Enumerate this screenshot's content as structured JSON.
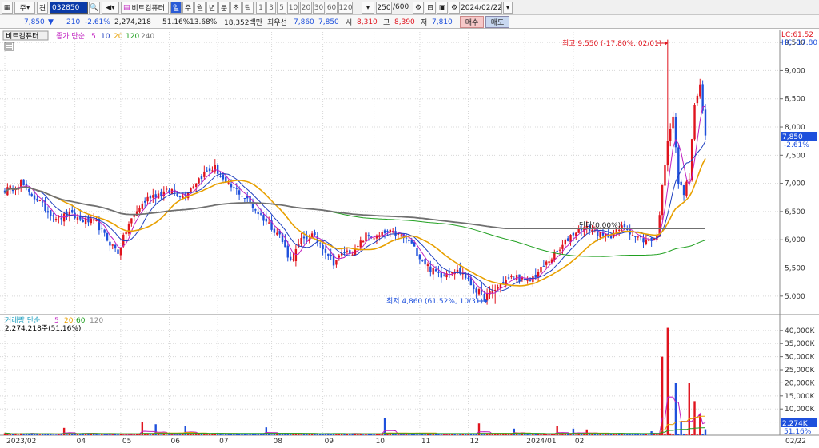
{
  "toolbar": {
    "period_mode": "주",
    "code_prefix": "견",
    "stock_code": "032850",
    "stock_name": "비트컴퓨터",
    "periods": [
      "일",
      "주",
      "월",
      "년",
      "분",
      "초",
      "틱"
    ],
    "minute_options": [
      "1",
      "3",
      "5",
      "10",
      "20",
      "30",
      "60",
      "120"
    ],
    "count": "250",
    "count_total": "/600",
    "date": "2024/02/22"
  },
  "quote": {
    "price": "7,850",
    "direction": "▼",
    "change": "210",
    "change_pct": "-2.61%",
    "volume": "2,274,218",
    "volume_ratio": "51.16%",
    "turnover": "13.68%",
    "amount": "18,352백만",
    "bid_label": "최우선",
    "ask": "7,860",
    "bid": "7,850",
    "open_label": "시",
    "open": "8,310",
    "high_label": "고",
    "high": "8,390",
    "low_label": "저",
    "low": "7,810",
    "buy_label": "매수",
    "sell_label": "매도"
  },
  "legend": {
    "name_tag": "비트컴퓨터",
    "ma_prefix": "종가 단순",
    "ma_periods": [
      "5",
      "10",
      "20",
      "120",
      "240"
    ],
    "vol_prefix": "거래량 단순",
    "vol_periods": [
      "5",
      "20",
      "60",
      "120"
    ],
    "vol_value": "2,274,218주(51.16%)"
  },
  "annotations": {
    "high": "최고 9,550 (-17.80%, 02/01)",
    "low": "최저 4,860 (61.52%, 10/31)",
    "mid": "단타(0.00%)",
    "lc": "LC:61.52",
    "hc": "HC:-17.80",
    "price_tag": "7,850",
    "pct_tag": "-2.61%",
    "vol_tag": "2,274K",
    "vol_pct_tag": "51.16%"
  },
  "colors": {
    "up": "#e0141e",
    "down": "#1e50dc",
    "ma5": "#c020c0",
    "ma10": "#2040c0",
    "ma20": "#e8a000",
    "ma120": "#20a020",
    "ma240": "#707070"
  },
  "chart_data": {
    "type": "candlestick",
    "title": "비트컴퓨터",
    "ylim": [
      4700,
      9700
    ],
    "y_ticks": [
      "5,000",
      "5,500",
      "6,000",
      "6,500",
      "7,000",
      "7,500",
      "8,000",
      "8,500",
      "9,000",
      "9,500"
    ],
    "x_ticks": [
      "2023/02",
      "04",
      "05",
      "06",
      "07",
      "08",
      "09",
      "10",
      "11",
      "12",
      "2024/01",
      "02",
      "02/22"
    ],
    "keypoints": {
      "high": 9550,
      "low": 4860,
      "last_close": 7850
    },
    "price_anchors": [
      [
        0,
        6880
      ],
      [
        3,
        6920
      ],
      [
        6,
        7020
      ],
      [
        9,
        6820
      ],
      [
        12,
        6720
      ],
      [
        16,
        6500
      ],
      [
        20,
        6380
      ],
      [
        24,
        6450
      ],
      [
        28,
        6360
      ],
      [
        34,
        6300
      ],
      [
        38,
        6000
      ],
      [
        42,
        5780
      ],
      [
        46,
        6280
      ],
      [
        50,
        6580
      ],
      [
        54,
        6780
      ],
      [
        58,
        6820
      ],
      [
        62,
        6880
      ],
      [
        66,
        6780
      ],
      [
        70,
        6980
      ],
      [
        74,
        7180
      ],
      [
        78,
        7280
      ],
      [
        82,
        6980
      ],
      [
        86,
        6880
      ],
      [
        90,
        6700
      ],
      [
        94,
        6480
      ],
      [
        98,
        6280
      ],
      [
        102,
        6080
      ],
      [
        106,
        5620
      ],
      [
        110,
        5980
      ],
      [
        114,
        6080
      ],
      [
        118,
        5880
      ],
      [
        122,
        5600
      ],
      [
        126,
        5780
      ],
      [
        130,
        5800
      ],
      [
        134,
        6080
      ],
      [
        138,
        6040
      ],
      [
        142,
        6140
      ],
      [
        146,
        6080
      ],
      [
        150,
        5980
      ],
      [
        154,
        5700
      ],
      [
        158,
        5480
      ],
      [
        162,
        5380
      ],
      [
        166,
        5480
      ],
      [
        170,
        5400
      ],
      [
        174,
        5150
      ],
      [
        178,
        4980
      ],
      [
        182,
        5120
      ],
      [
        186,
        5280
      ],
      [
        190,
        5350
      ],
      [
        194,
        5250
      ],
      [
        198,
        5420
      ],
      [
        202,
        5640
      ],
      [
        206,
        5820
      ],
      [
        210,
        6080
      ],
      [
        214,
        6220
      ],
      [
        218,
        6180
      ],
      [
        222,
        6050
      ],
      [
        226,
        6100
      ],
      [
        230,
        6250
      ],
      [
        234,
        6050
      ],
      [
        238,
        5980
      ],
      [
        242,
        6050
      ],
      [
        246,
        7800
      ],
      [
        248,
        8200
      ],
      [
        250,
        7000
      ],
      [
        252,
        6850
      ],
      [
        254,
        7100
      ],
      [
        256,
        8400
      ],
      [
        258,
        8700
      ],
      [
        260,
        7850
      ]
    ],
    "volume_ylim": [
      0,
      43000
    ],
    "volume_unit": "K",
    "volume_ticks": [
      "5,000K",
      "10,000K",
      "15,000K",
      "20,000K",
      "25,000K",
      "30,000K",
      "35,000K",
      "40,000K"
    ],
    "volume_spikes": [
      [
        22,
        2800
      ],
      [
        51,
        5000
      ],
      [
        56,
        4200
      ],
      [
        67,
        3500
      ],
      [
        97,
        3000
      ],
      [
        141,
        6500
      ],
      [
        176,
        4500
      ],
      [
        189,
        2500
      ],
      [
        205,
        3500
      ],
      [
        211,
        2500
      ],
      [
        216,
        2200
      ],
      [
        240,
        1500
      ],
      [
        244,
        30000
      ],
      [
        246,
        41000
      ],
      [
        249,
        20000
      ],
      [
        251,
        5000
      ],
      [
        254,
        20000
      ],
      [
        256,
        13000
      ],
      [
        258,
        8000
      ],
      [
        260,
        2274
      ]
    ]
  }
}
